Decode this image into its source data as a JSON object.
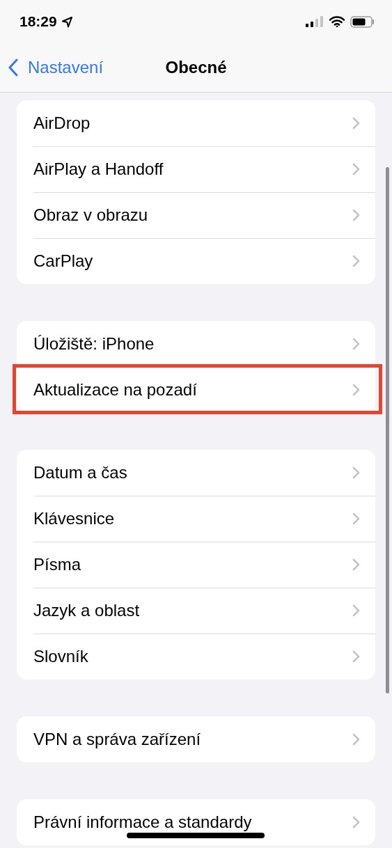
{
  "status_bar": {
    "time": "18:29"
  },
  "nav": {
    "back": "Nastavení",
    "title": "Obecné"
  },
  "groups": [
    {
      "rows": [
        {
          "label": "AirDrop",
          "highlighted": false
        },
        {
          "label": "AirPlay a Handoff",
          "highlighted": false
        },
        {
          "label": "Obraz v obrazu",
          "highlighted": false
        },
        {
          "label": "CarPlay",
          "highlighted": false
        }
      ]
    },
    {
      "rows": [
        {
          "label": "Úložiště: iPhone",
          "highlighted": false
        },
        {
          "label": "Aktualizace na pozadí",
          "highlighted": true
        }
      ]
    },
    {
      "rows": [
        {
          "label": "Datum a čas",
          "highlighted": false
        },
        {
          "label": "Klávesnice",
          "highlighted": false
        },
        {
          "label": "Písma",
          "highlighted": false
        },
        {
          "label": "Jazyk a oblast",
          "highlighted": false
        },
        {
          "label": "Slovník",
          "highlighted": false
        }
      ]
    },
    {
      "rows": [
        {
          "label": "VPN a správa zařízení",
          "highlighted": false
        }
      ]
    },
    {
      "rows": [
        {
          "label": "Právní informace a standardy",
          "highlighted": false
        }
      ]
    }
  ]
}
